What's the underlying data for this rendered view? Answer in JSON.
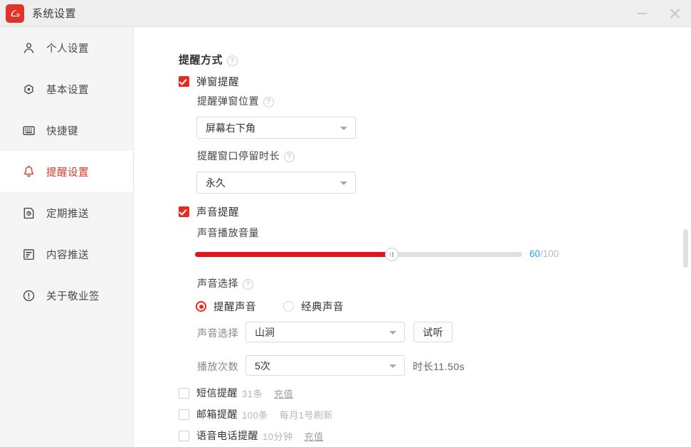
{
  "window": {
    "title": "系统设置",
    "app_icon": "jingyeqian-logo-icon",
    "minimize_label": "最小化",
    "close_label": "关闭"
  },
  "sidebar": {
    "items": [
      {
        "id": "personal",
        "label": "个人设置",
        "icon": "user-icon",
        "active": false
      },
      {
        "id": "basic",
        "label": "基本设置",
        "icon": "gear-icon",
        "active": false
      },
      {
        "id": "shortcut",
        "label": "快捷键",
        "icon": "keyboard-icon",
        "active": false
      },
      {
        "id": "reminder",
        "label": "提醒设置",
        "icon": "bell-icon",
        "active": true
      },
      {
        "id": "schedule",
        "label": "定期推送",
        "icon": "clock-page-icon",
        "active": false
      },
      {
        "id": "content",
        "label": "内容推送",
        "icon": "document-icon",
        "active": false
      },
      {
        "id": "about",
        "label": "关于敬业签",
        "icon": "info-icon",
        "active": false
      }
    ],
    "active_color": "#d93a2b"
  },
  "main": {
    "section_title": "提醒方式",
    "help_glyph": "?",
    "popup_reminder": {
      "label": "弹窗提醒",
      "checked": true,
      "position_label": "提醒弹窗位置",
      "position_value": "屏幕右下角",
      "duration_label": "提醒窗口停留时长",
      "duration_value": "永久"
    },
    "sound_reminder": {
      "label": "声音提醒",
      "checked": true,
      "volume_label": "声音播放音量",
      "volume_value": 60,
      "volume_max": 100,
      "volume_value_text": "60",
      "volume_max_text": "/100",
      "volume_accent": "#e2141e",
      "volume_value_color": "#2ba3f0",
      "sound_select_label": "声音选择",
      "radios": [
        {
          "id": "reminder-sound",
          "label": "提醒声音",
          "selected": true
        },
        {
          "id": "classic-sound",
          "label": "经典声音",
          "selected": false
        }
      ],
      "sound_field_label": "声音选择",
      "sound_value": "山涧",
      "preview_button": "试听",
      "play_count_label": "播放次数",
      "play_count_value": "5次",
      "duration_text": "时长11.50s"
    },
    "other_options": [
      {
        "id": "sms",
        "label": "短信提醒",
        "checked": false,
        "count": "31条",
        "extra": "充值",
        "extra_is_link": true
      },
      {
        "id": "email",
        "label": "邮箱提醒",
        "checked": false,
        "count": "100条",
        "extra": "每月1号刷新",
        "extra_is_link": false
      },
      {
        "id": "voice",
        "label": "语音电话提醒",
        "checked": false,
        "count": "10分钟",
        "extra": "充值",
        "extra_is_link": true
      }
    ]
  },
  "scrollbar": {
    "name": "content-scrollbar"
  }
}
